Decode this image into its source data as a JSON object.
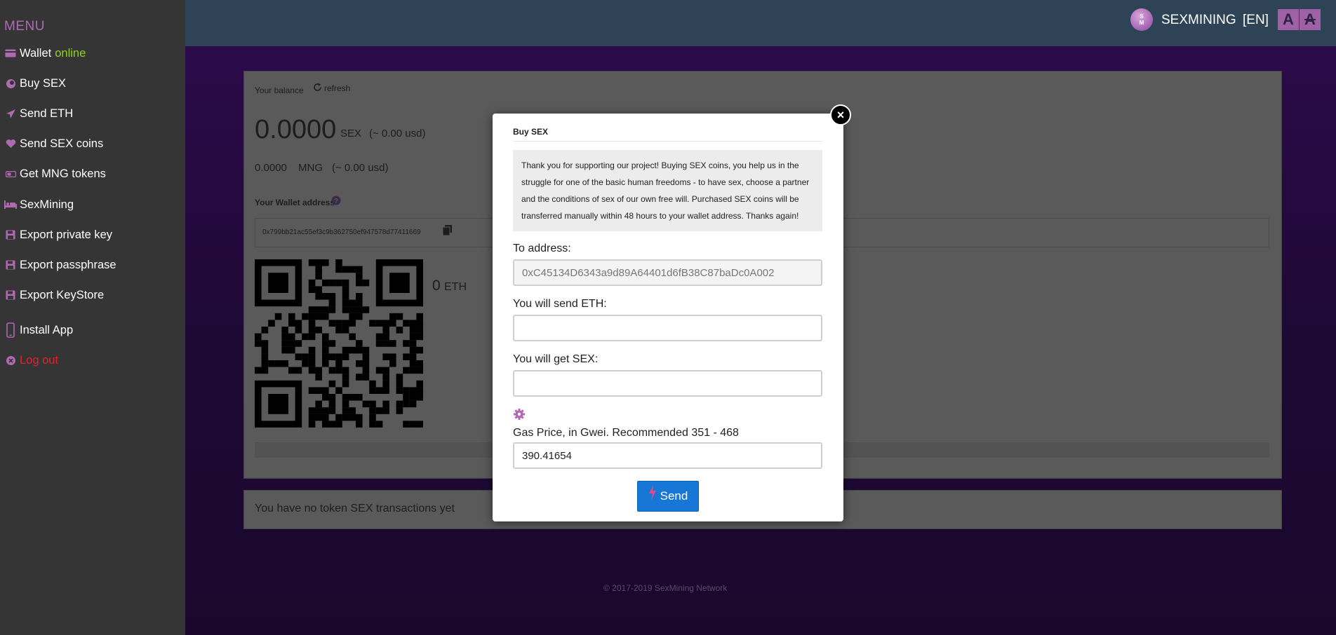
{
  "sidebar": {
    "menu_title": "MENU",
    "items": [
      {
        "label": "Wallet",
        "status": "online",
        "icon": "wallet-icon"
      },
      {
        "label": "Buy SEX",
        "icon": "coin-icon"
      },
      {
        "label": "Send ETH",
        "icon": "paper-plane-icon"
      },
      {
        "label": "Send SEX coins",
        "icon": "heart-icon"
      },
      {
        "label": "Get MNG tokens",
        "icon": "token-icon"
      },
      {
        "label": "SexMining",
        "icon": "bed-icon"
      },
      {
        "label": "Export private key",
        "icon": "floppy-icon"
      },
      {
        "label": "Export passphrase",
        "icon": "floppy-icon"
      },
      {
        "label": "Export KeyStore",
        "icon": "floppy-icon"
      },
      {
        "label": "Install App",
        "icon": "phone-icon"
      },
      {
        "label": "Log out",
        "icon": "close-circle-icon"
      }
    ]
  },
  "header": {
    "logo_top": "S",
    "logo_bottom": "M",
    "brand": "SEXMINING",
    "lang": "[EN]",
    "font_increase": "A",
    "font_decrease": "A"
  },
  "wallet": {
    "balance_label": "Your balance",
    "refresh_label": "refresh",
    "sex_amount": "0.0000",
    "sex_unit": "SEX",
    "sex_usd": "(~ 0.00 usd)",
    "mng_amount": "0.0000",
    "mng_unit": "MNG",
    "mng_usd": "(~ 0.00 usd)",
    "address_label": "Your Wallet address",
    "address": "0x799bb21ac55ef3c9b362750ef947578d77411669",
    "eth_amount": "0",
    "eth_unit": "ETH",
    "no_tx": "You have no token SEX transactions yet"
  },
  "footer": "© 2017-2019 SexMining Network",
  "modal": {
    "close": "×",
    "title": "Buy SEX",
    "note": "Thank you for supporting our project! Buying SEX coins, you help us in the struggle for one of the basic human freedoms - to have sex, choose a partner and the conditions of sex of our own free will. Purchased SEX coins will be transferred manually within 48 hours to your wallet address. Thanks again!",
    "to_label": "To address:",
    "to_value": "0xC45134D6343a9d89A64401d6fB38C87baDc0A002",
    "eth_label": "You will send ETH:",
    "eth_value": "",
    "sex_label": "You will get SEX:",
    "sex_value": "",
    "gas_label": "Gas Price, in Gwei. Recommended 351 - 468",
    "gas_value": "390.41654",
    "send_label": "Send"
  },
  "colors": {
    "sidebar_bg": "#353535",
    "header_bg": "#2f4357",
    "accent": "#b06ab2",
    "online": "#8fd61a",
    "logout": "#e0232a",
    "send_button": "#1677d6"
  }
}
